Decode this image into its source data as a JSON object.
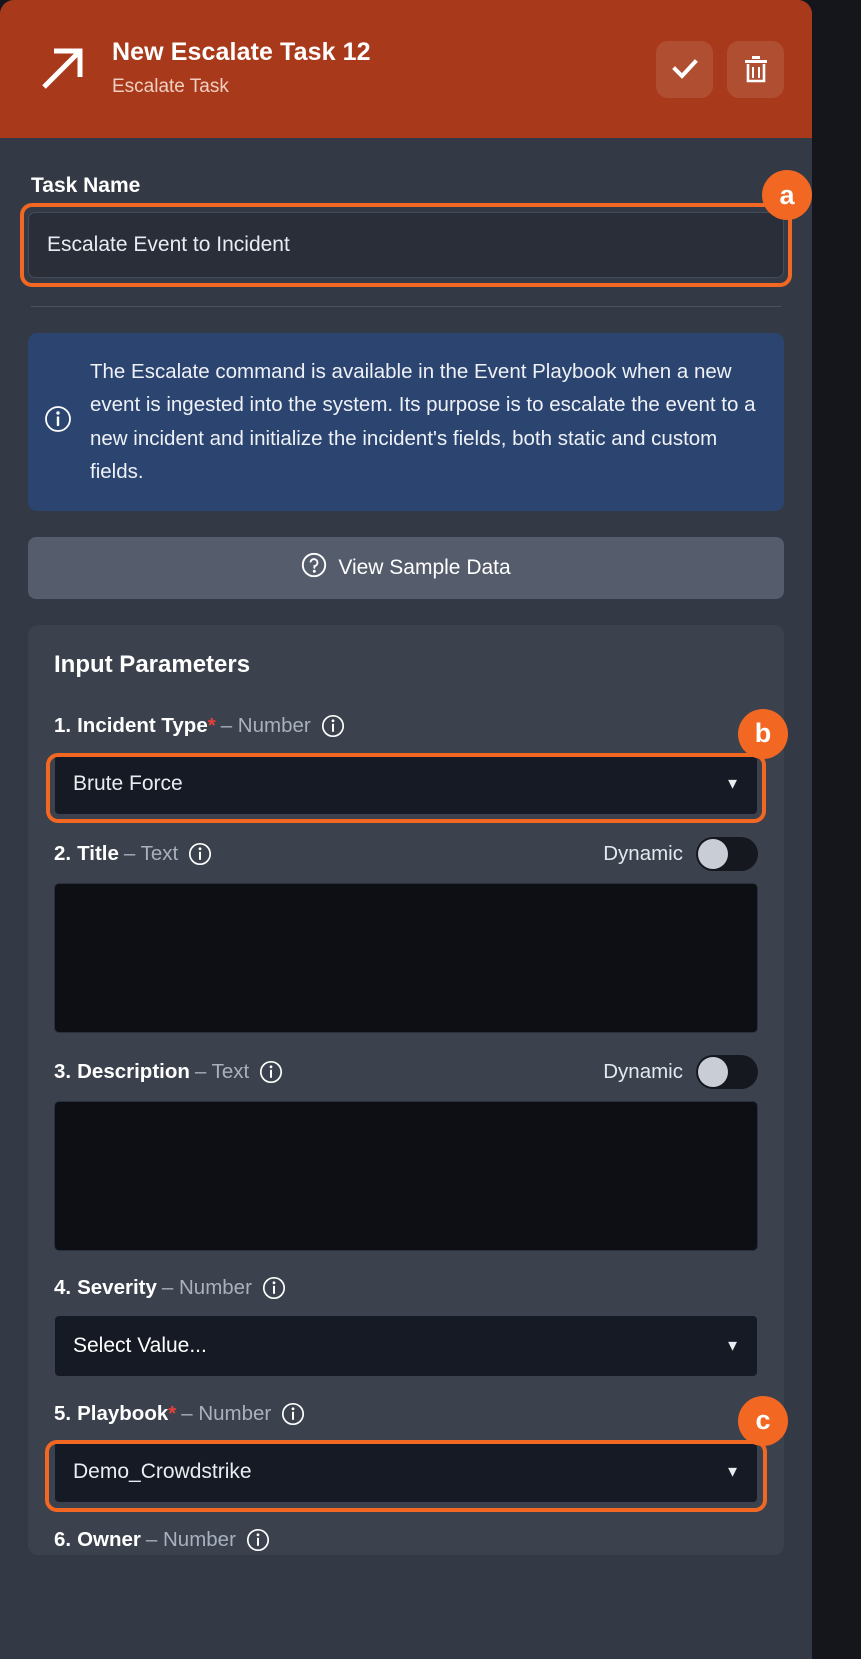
{
  "header": {
    "title": "New Escalate Task 12",
    "subtitle": "Escalate Task",
    "icon": "arrow-up-right-icon",
    "confirm_label": "check-icon",
    "delete_label": "trash-icon",
    "bg_color": "#a83a1b"
  },
  "task_name": {
    "label": "Task Name",
    "value": "Escalate Event to Incident",
    "placeholder": "Task Name"
  },
  "info": {
    "icon": "info-circle-icon",
    "text": "The Escalate command is available in the Event Playbook when a new event is ingested into the system. Its purpose is to escalate the event to a new incident and initialize the incident's fields, both static and custom fields.",
    "bg_color": "#2c4570"
  },
  "sample_button": {
    "label": "View Sample Data",
    "icon": "question-circle-icon"
  },
  "params_section": {
    "title": "Input Parameters"
  },
  "params": [
    {
      "index": "1.",
      "name": "Incident Type",
      "required": "*",
      "type": "– Number",
      "control": "select",
      "value": "Brute Force",
      "dynamic": null,
      "highlight": "b"
    },
    {
      "index": "2.",
      "name": "Title",
      "required": "",
      "type": "– Text",
      "control": "textarea",
      "value": "",
      "dynamic": "Dynamic",
      "dynamic_on": false,
      "highlight": null
    },
    {
      "index": "3.",
      "name": "Description",
      "required": "",
      "type": "– Text",
      "control": "textarea",
      "value": "",
      "dynamic": "Dynamic",
      "dynamic_on": false,
      "highlight": null
    },
    {
      "index": "4.",
      "name": "Severity",
      "required": "",
      "type": "– Number",
      "control": "select",
      "value": "Select Value...",
      "dynamic": null,
      "highlight": null
    },
    {
      "index": "5.",
      "name": "Playbook",
      "required": "*",
      "type": "– Number",
      "control": "select",
      "value": "Demo_Crowdstrike",
      "dynamic": null,
      "highlight": "c"
    },
    {
      "index": "6.",
      "name": "Owner",
      "required": "",
      "type": "– Number",
      "control": "none",
      "value": "",
      "dynamic": null,
      "highlight": null
    }
  ],
  "annotations": {
    "a": "a",
    "b": "b",
    "c": "c",
    "color": "#f26722"
  }
}
